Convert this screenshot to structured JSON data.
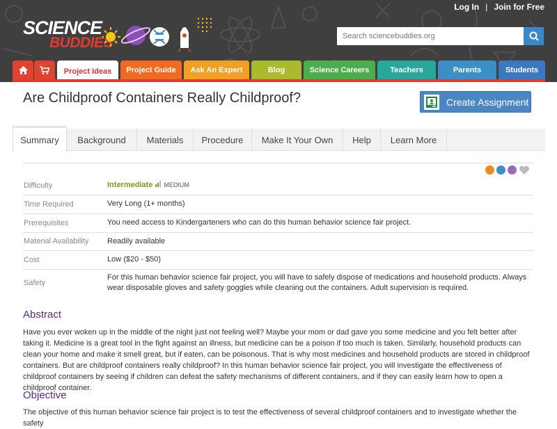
{
  "header": {
    "login_label": "Log In",
    "separator": "|",
    "join_label": "Join for Free",
    "logo_line1": "SCIENCE",
    "logo_line2": "BUDDIES",
    "search_placeholder": "Search sciencebuddies.org"
  },
  "nav": {
    "items": [
      {
        "label": "",
        "icon": "home-icon",
        "color": "#e0432f"
      },
      {
        "label": "",
        "icon": "cart-icon",
        "color": "#e0432f"
      },
      {
        "label": "Project Ideas",
        "color": "#ffffff"
      },
      {
        "label": "Project Guide",
        "color": "#f06a22"
      },
      {
        "label": "Ask An Expert",
        "color": "#f2a024"
      },
      {
        "label": "Blog",
        "color": "#a9bb2c"
      },
      {
        "label": "Science Careers",
        "color": "#4aae4a"
      },
      {
        "label": "Teachers",
        "color": "#2aa79b"
      },
      {
        "label": "Parents",
        "color": "#3b8fc6"
      },
      {
        "label": "Students",
        "color": "#3a78c2"
      }
    ]
  },
  "page": {
    "title": "Are Childproof Containers Really Childproof?",
    "create_assignment": "Create Assignment"
  },
  "tabs": [
    "Summary",
    "Background",
    "Materials",
    "Procedure",
    "Make It Your Own",
    "Help",
    "Learn More"
  ],
  "details": {
    "difficulty_label": "Difficulty",
    "difficulty_value": "Intermediate",
    "difficulty_level": "MEDIUM",
    "time_label": "Time Required",
    "time_value": "Very Long (1+ months)",
    "prereq_label": "Prerequisites",
    "prereq_value": "You need access to Kindergarteners who can do this human behavior science fair project.",
    "availability_label": "Material Availability",
    "availability_value": "Readily available",
    "cost_label": "Cost",
    "cost_value": "Low ($20 - $50)",
    "safety_label": "Safety",
    "safety_value": "For this human behavior science fair project, you will have to safely dispose of medications and household products. Always wear disposable gloves and safety goggles while cleaning out the containers. Adult supervision is required."
  },
  "share_icons": [
    {
      "name": "share-icon",
      "color": "#f08a24"
    },
    {
      "name": "print-icon",
      "color": "#3b8fc6"
    },
    {
      "name": "email-icon",
      "color": "#9b6bb6"
    },
    {
      "name": "favorite-icon",
      "color": "#bbbbbb"
    }
  ],
  "abstract": {
    "heading": "Abstract",
    "text": "Have you ever woken up in the middle of the night just not feeling well? Maybe your mom or dad gave you some medicine and you felt better after taking it. Medicine is a great tool in the fight against an illness, but medicine can be a poison if too much is taken. Similarly, household products can clean your home and make it smell great, but if eaten, can be poisonous. That is why most medicines and household products are stored in childproof containers. But are childproof containers really childproof? In this human behavior science fair project, you will investigate the effectiveness of childproof containers by seeing if children can defeat the safety mechanisms of different containers, and if they can easily learn how to open a childproof container."
  },
  "objective": {
    "heading": "Objective",
    "text": "The objective of this human behavior science fair project is to test the effectiveness of several childproof containers and to investigate whether the safety"
  }
}
